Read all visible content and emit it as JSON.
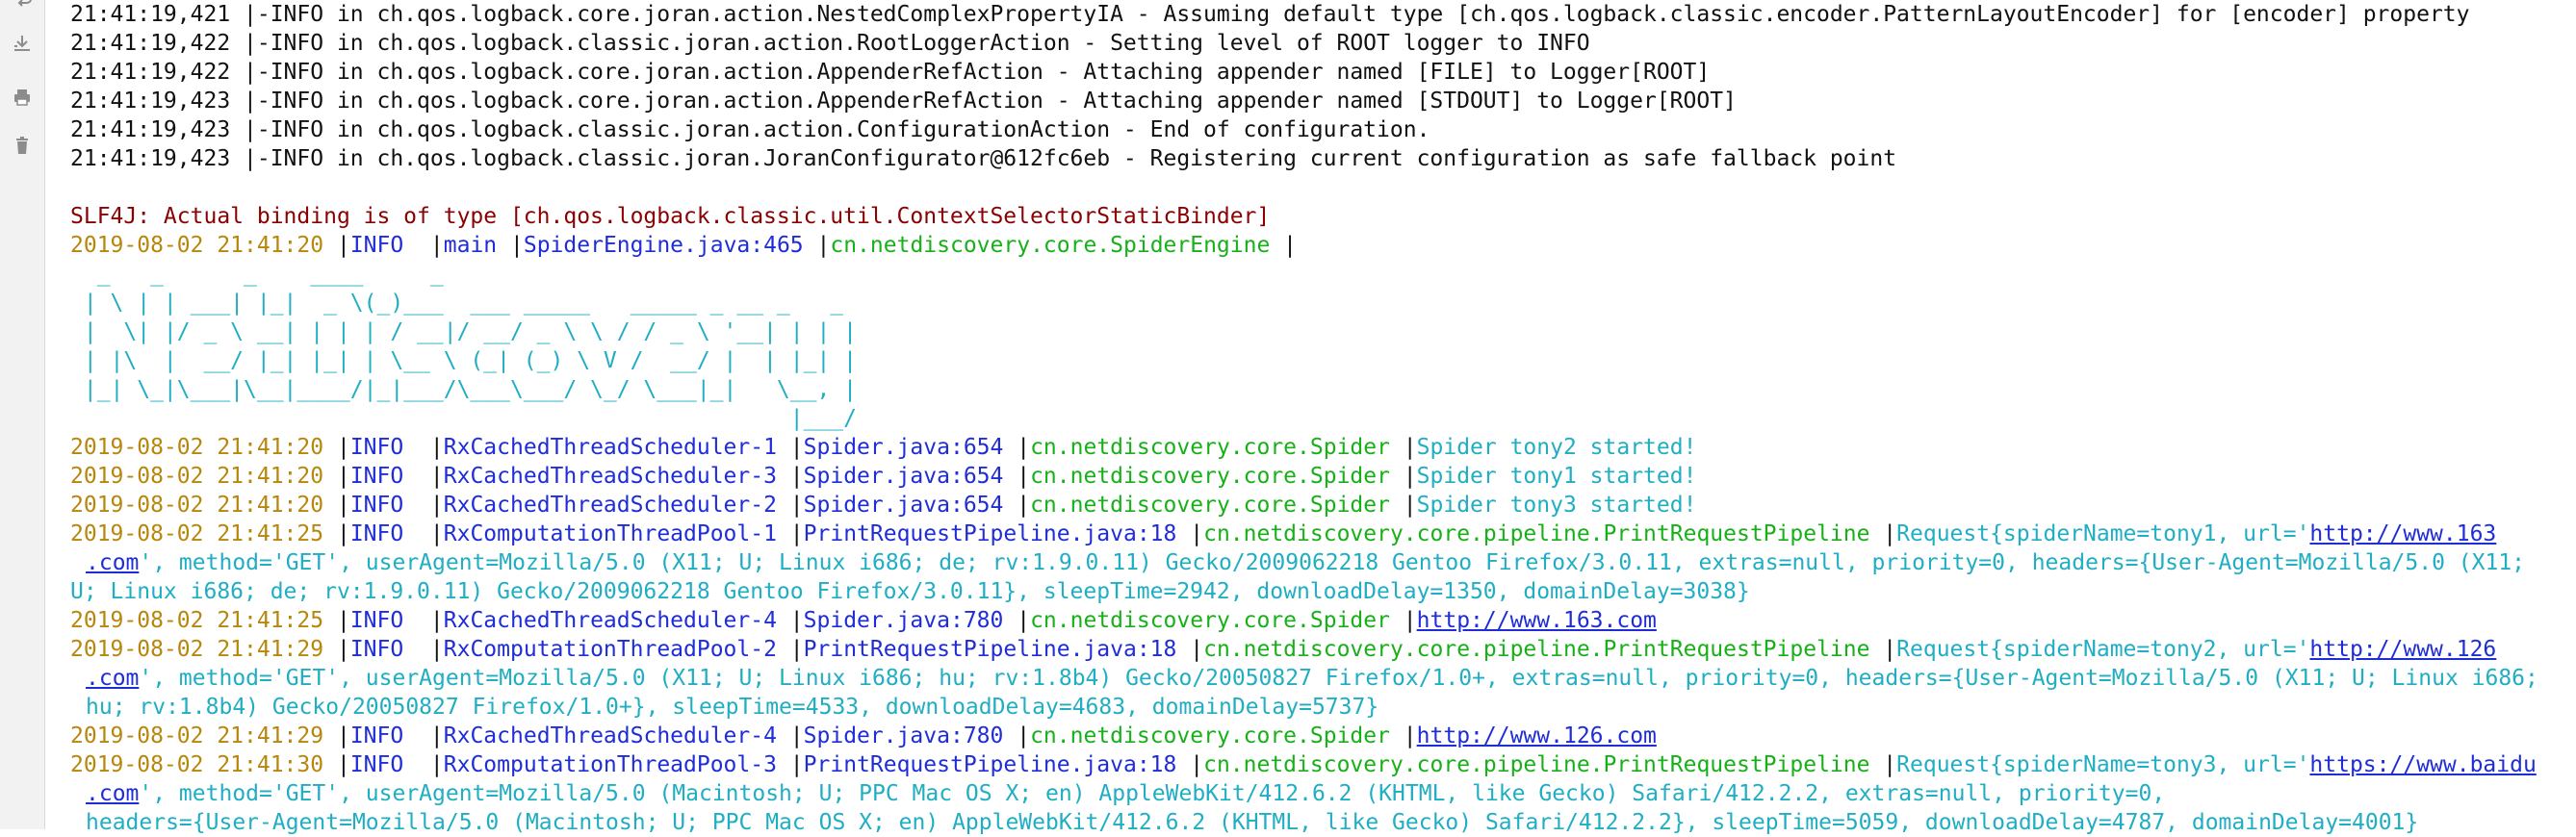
{
  "gutter": {
    "icons": [
      "soft-wrap-icon",
      "scroll-to-end-icon",
      "print-icon",
      "clear-all-icon"
    ]
  },
  "init_lines": [
    "21:41:19,421 |-INFO in ch.qos.logback.core.joran.action.NestedComplexPropertyIA - Assuming default type [ch.qos.logback.classic.encoder.PatternLayoutEncoder] for [encoder] property",
    "21:41:19,422 |-INFO in ch.qos.logback.classic.joran.action.RootLoggerAction - Setting level of ROOT logger to INFO",
    "21:41:19,422 |-INFO in ch.qos.logback.core.joran.action.AppenderRefAction - Attaching appender named [FILE] to Logger[ROOT]",
    "21:41:19,423 |-INFO in ch.qos.logback.core.joran.action.AppenderRefAction - Attaching appender named [STDOUT] to Logger[ROOT]",
    "21:41:19,423 |-INFO in ch.qos.logback.classic.joran.action.ConfigurationAction - End of configuration.",
    "21:41:19,423 |-INFO in ch.qos.logback.classic.joran.JoranConfigurator@612fc6eb - Registering current configuration as safe fallback point"
  ],
  "slf4j": "SLF4J: Actual binding is of type [ch.qos.logback.classic.util.ContextSelectorStaticBinder]",
  "engine_line": {
    "ts": "2019-08-02 21:41:20",
    "level": "INFO ",
    "thread": "main",
    "source": "SpiderEngine.java:465",
    "logger": "cn.netdiscovery.core.SpiderEngine"
  },
  "banner": [
    "  _   _      _    ____     _                                       ",
    " | \\ | | ___| |_|  _ \\(_)___  ___ _____   _____ _ __ _   _ ",
    " |  \\| |/ _ \\ __| | | | / __|/ __/ _ \\ \\ / / _ \\ '__| | | |",
    " | |\\  |  __/ |_| |_| | \\__ \\ (_| (_) \\ V /  __/ |  | |_| |",
    " |_| \\_|\\___|\\__|____/|_|___/\\___\\___/ \\_/ \\___|_|   \\__, |",
    "                                                      |___/ "
  ],
  "spider_lines": [
    {
      "ts": "2019-08-02 21:41:20",
      "level": "INFO ",
      "thread": "RxCachedThreadScheduler-1",
      "source": "Spider.java:654",
      "logger": "cn.netdiscovery.core.Spider",
      "message": "Spider tony2 started!"
    },
    {
      "ts": "2019-08-02 21:41:20",
      "level": "INFO ",
      "thread": "RxCachedThreadScheduler-3",
      "source": "Spider.java:654",
      "logger": "cn.netdiscovery.core.Spider",
      "message": "Spider tony1 started!"
    },
    {
      "ts": "2019-08-02 21:41:20",
      "level": "INFO ",
      "thread": "RxCachedThreadScheduler-2",
      "source": "Spider.java:654",
      "logger": "cn.netdiscovery.core.Spider",
      "message": "Spider tony3 started!"
    }
  ],
  "request1": {
    "ts": "2019-08-02 21:41:25",
    "level": "INFO ",
    "thread": "RxComputationThreadPool-1",
    "source": "PrintRequestPipeline.java:18",
    "logger": "cn.netdiscovery.core.pipeline.PrintRequestPipeline",
    "message_a": "Request{spiderName=tony1, url='",
    "url_a": "http://www.163",
    "url_b": ".com",
    "cont1": "', method='GET', userAgent=Mozilla/5.0 (X11; U; Linux i686; de; rv:1.9.0.11) Gecko/2009062218 Gentoo Firefox/3.0.11, extras=null, priority=0, headers={User-Agent=Mozilla/5.0 (X11;",
    "cont2": "U; Linux i686; de; rv:1.9.0.11) Gecko/2009062218 Gentoo Firefox/3.0.11}, sleepTime=2942, downloadDelay=1350, domainDelay=3038}"
  },
  "fetch1": {
    "ts": "2019-08-02 21:41:25",
    "level": "INFO ",
    "thread": "RxCachedThreadScheduler-4",
    "source": "Spider.java:780",
    "logger": "cn.netdiscovery.core.Spider",
    "url": "http://www.163.com"
  },
  "request2": {
    "ts": "2019-08-02 21:41:29",
    "level": "INFO ",
    "thread": "RxComputationThreadPool-2",
    "source": "PrintRequestPipeline.java:18",
    "logger": "cn.netdiscovery.core.pipeline.PrintRequestPipeline",
    "message_a": "Request{spiderName=tony2, url='",
    "url_a": "http://www.126",
    "url_b": ".com",
    "cont1": "', method='GET', userAgent=Mozilla/5.0 (X11; U; Linux i686; hu; rv:1.8b4) Gecko/20050827 Firefox/1.0+, extras=null, priority=0, headers={User-Agent=Mozilla/5.0 (X11; U; Linux i686;",
    "cont2": "hu; rv:1.8b4) Gecko/20050827 Firefox/1.0+}, sleepTime=4533, downloadDelay=4683, domainDelay=5737}"
  },
  "fetch2": {
    "ts": "2019-08-02 21:41:29",
    "level": "INFO ",
    "thread": "RxCachedThreadScheduler-4",
    "source": "Spider.java:780",
    "logger": "cn.netdiscovery.core.Spider",
    "url": "http://www.126.com"
  },
  "request3": {
    "ts": "2019-08-02 21:41:30",
    "level": "INFO ",
    "thread": "RxComputationThreadPool-3",
    "source": "PrintRequestPipeline.java:18",
    "logger": "cn.netdiscovery.core.pipeline.PrintRequestPipeline",
    "message_a": "Request{spiderName=tony3, url='",
    "url_a": "https://www.baidu",
    "url_b": ".com",
    "cont1": "', method='GET', userAgent=Mozilla/5.0 (Macintosh; U; PPC Mac OS X; en) AppleWebKit/412.6.2 (KHTML, like Gecko) Safari/412.2.2, extras=null, priority=0,",
    "cont2": "headers={User-Agent=Mozilla/5.0 (Macintosh; U; PPC Mac OS X; en) AppleWebKit/412.6.2 (KHTML, like Gecko) Safari/412.2.2}, sleepTime=5059, downloadDelay=4787, domainDelay=4001}"
  },
  "sep": " |"
}
